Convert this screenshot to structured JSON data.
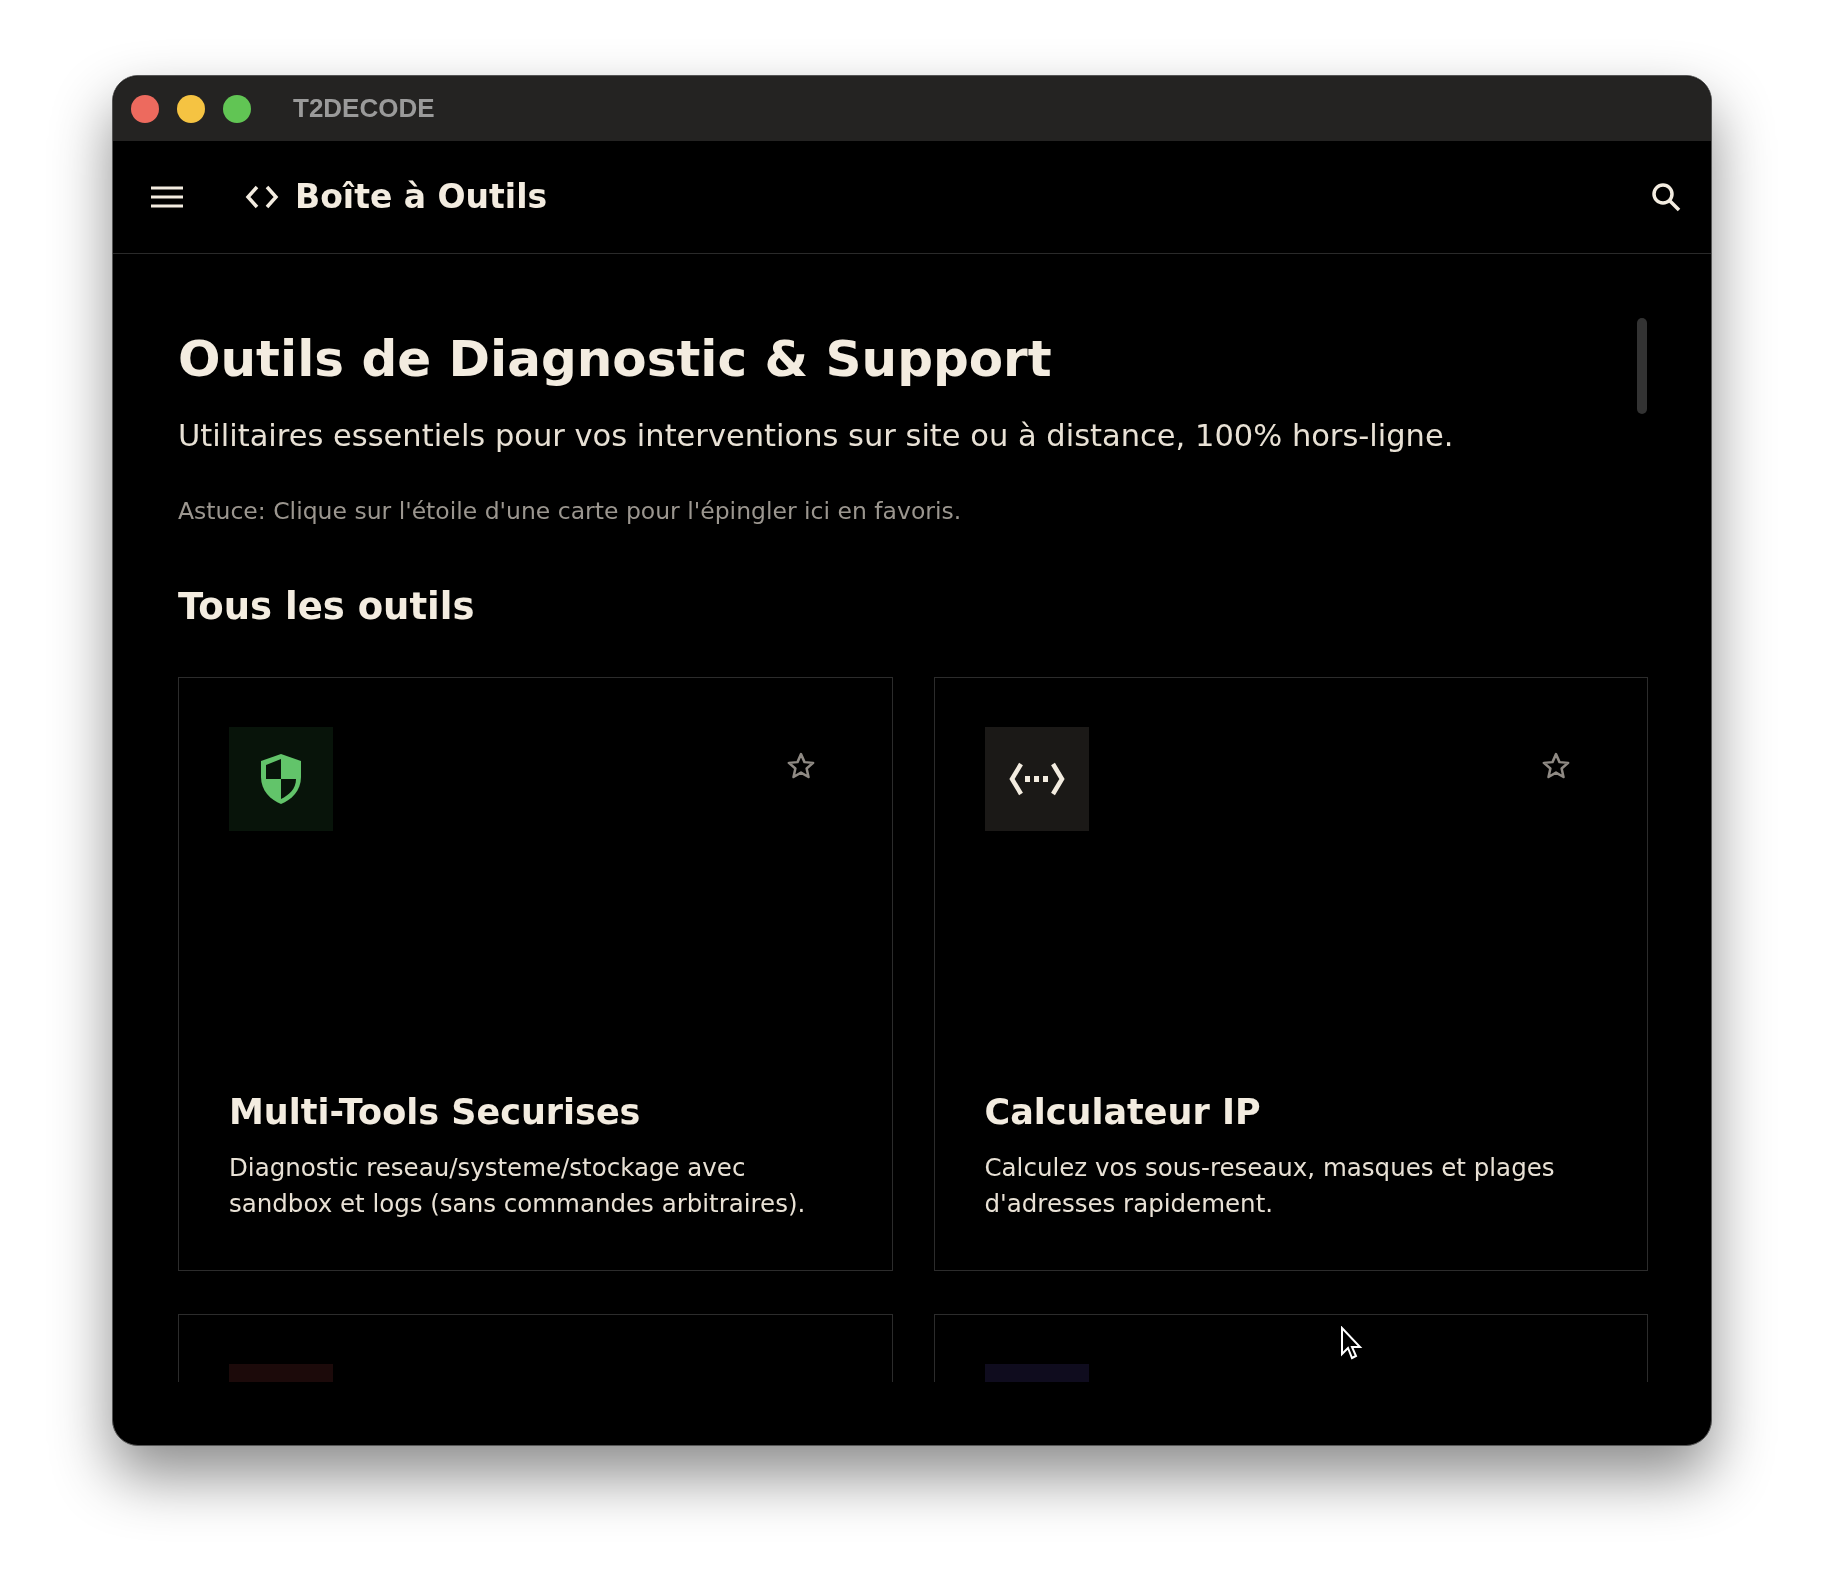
{
  "window": {
    "title": "T2DECODE"
  },
  "header": {
    "brand": "Boîte à Outils"
  },
  "page": {
    "title": "Outils de Diagnostic & Support",
    "subtitle": "Utilitaires essentiels pour vos interventions sur site ou à distance, 100% hors-ligne.",
    "hint": "Astuce: Clique sur l'étoile d'une carte pour l'épingler ici en favoris."
  },
  "section": {
    "title": "Tous les outils"
  },
  "cards": [
    {
      "kind": "shield",
      "color": "#08140a",
      "title": "Multi-Tools Securises",
      "description": "Diagnostic reseau/systeme/stockage avec sandbox et logs (sans commandes arbitraires).",
      "pinned": false
    },
    {
      "kind": "code",
      "color": "#1b1917",
      "title": "Calculateur IP",
      "description": "Calculez vos sous-reseaux, masques et plages d'adresses rapidement.",
      "pinned": false
    },
    {
      "kind": "partial",
      "color": "#1c0a0a"
    },
    {
      "kind": "partial",
      "color": "#0f0c1e"
    }
  ]
}
